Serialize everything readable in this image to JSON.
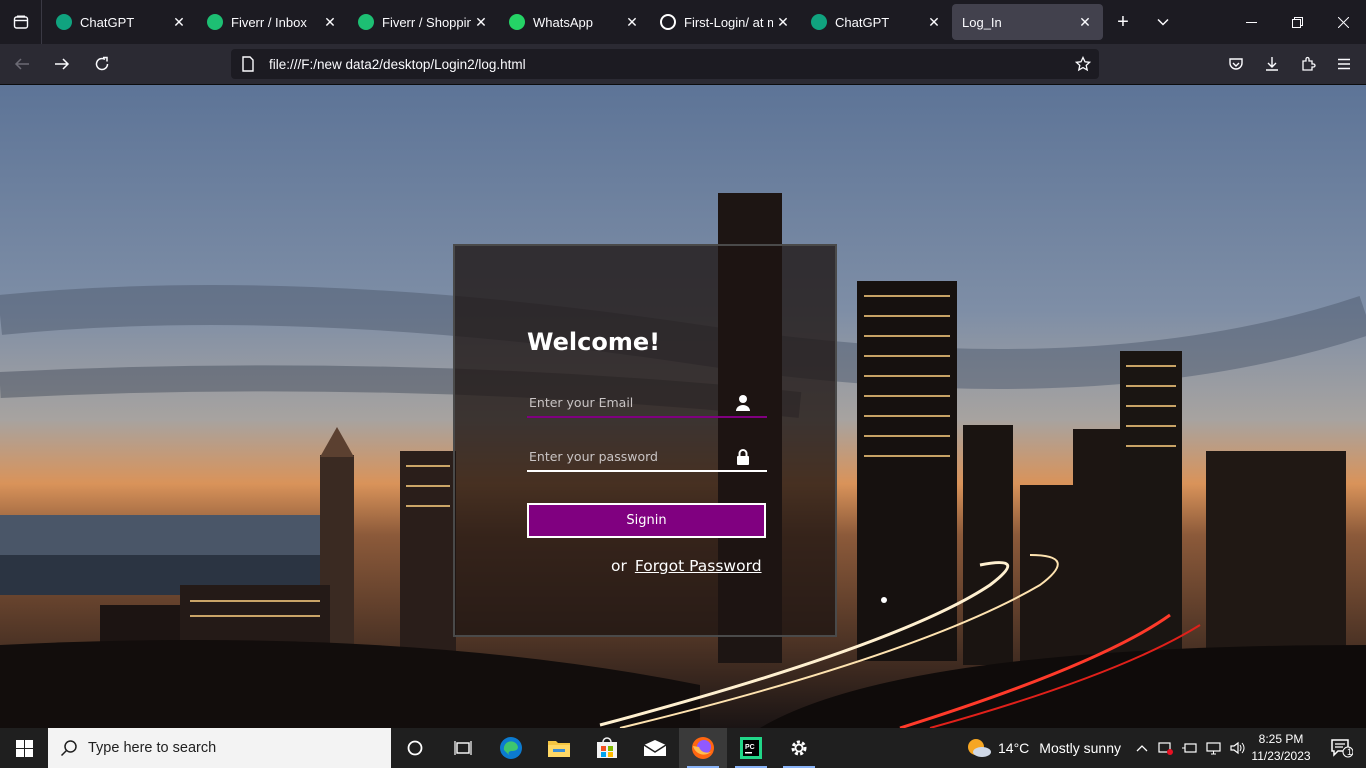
{
  "browser": {
    "tabs": [
      {
        "title": "ChatGPT",
        "favicon": "chatgpt-icon",
        "color": "#10a37f"
      },
      {
        "title": "Fiverr / Inbox",
        "favicon": "fiverr-icon",
        "color": "#1dbf73"
      },
      {
        "title": "Fiverr / Shopping",
        "favicon": "fiverr-icon",
        "color": "#1dbf73"
      },
      {
        "title": "WhatsApp",
        "favicon": "whatsapp-icon",
        "color": "#25d366"
      },
      {
        "title": "First-Login/ at ma",
        "favicon": "github-icon",
        "color": "#ffffff"
      },
      {
        "title": "ChatGPT",
        "favicon": "chatgpt-icon",
        "color": "#10a37f"
      },
      {
        "title": "Log_In",
        "favicon": "",
        "color": ""
      }
    ],
    "active_tab_index": 6,
    "url": "file:///F:/new data2/desktop/Login2/log.html"
  },
  "login": {
    "heading": "Welcome!",
    "email_placeholder": "Enter your Email",
    "password_placeholder": "Enter your password",
    "signin_label": "Signin",
    "or_text": "or",
    "forgot_label": "Forgot Password",
    "accent_color": "#800080"
  },
  "taskbar": {
    "search_placeholder": "Type here to search",
    "weather_temp": "14°C",
    "weather_text": "Mostly sunny",
    "time": "8:25 PM",
    "date": "11/23/2023",
    "notification_count": "1"
  }
}
